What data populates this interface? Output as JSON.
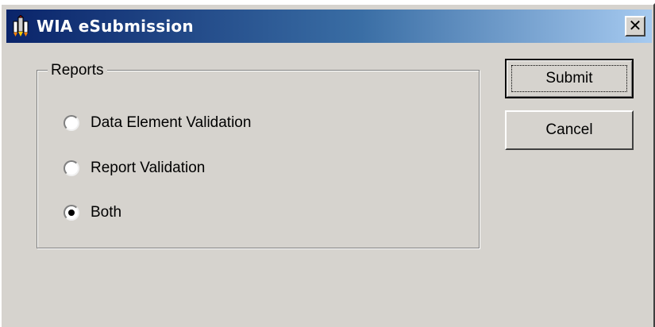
{
  "window": {
    "title": "WIA eSubmission",
    "close_glyph": "✕",
    "titlebar_colors": [
      "#0a246a",
      "#a6caf0"
    ],
    "face_color": "#d6d3ce"
  },
  "reports_group": {
    "legend": "Reports",
    "options": [
      {
        "label": "Data Element Validation",
        "selected": false
      },
      {
        "label": "Report Validation",
        "selected": false
      },
      {
        "label": "Both",
        "selected": true
      }
    ]
  },
  "buttons": {
    "submit_label": "Submit",
    "cancel_label": "Cancel"
  },
  "icons": {
    "app": "rocket-icon",
    "close": "close-icon"
  }
}
